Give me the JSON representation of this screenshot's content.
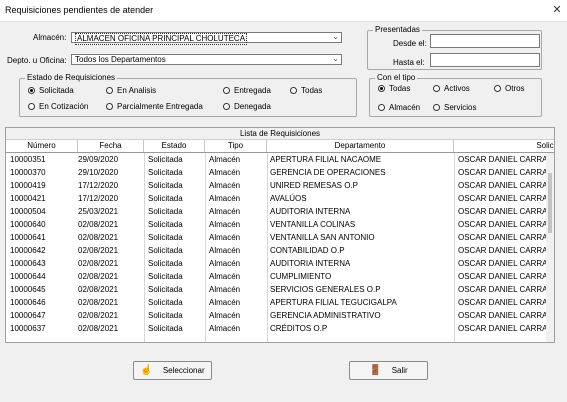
{
  "window": {
    "title": "Requisiciones pendientes de atender",
    "close": "✕"
  },
  "filters": {
    "almacen_label": "Almacén:",
    "almacen_value": "ALMACEN OFICINA PRINCIPAL CHOLUTECA",
    "depto_label": "Depto. u Oficina:",
    "depto_value": "Todos los Departamentos"
  },
  "estado_group": {
    "title": "Estado de Requisiciones",
    "options": [
      "Solicitada",
      "En Analisis",
      "Entregada",
      "Todas",
      "En Cotización",
      "Parcialmente Entregada",
      "Denegada"
    ],
    "selected": "Solicitada"
  },
  "presentadas": {
    "title": "Presentadas",
    "desde_label": "Desde el:",
    "hasta_label": "Hasta el:",
    "desde_value": "",
    "hasta_value": ""
  },
  "tipo_group": {
    "title": "Con el tipo",
    "options": [
      "Todas",
      "Activos",
      "Otros",
      "Almacén",
      "Servicios"
    ],
    "selected": "Todas"
  },
  "list": {
    "caption": "Lista de Requisiciones",
    "columns": [
      "Número",
      "Fecha",
      "Estado",
      "Tipo",
      "Departamento",
      "Solicitado"
    ],
    "rows": [
      [
        "10000351",
        "29/09/2020",
        "Solicitada",
        "Almacén",
        "APERTURA FILIAL NACAOME",
        "OSCAR DANIEL CARRA"
      ],
      [
        "10000370",
        "29/10/2020",
        "Solicitada",
        "Almacén",
        "GERENCIA DE OPERACIONES",
        "OSCAR DANIEL CARRA"
      ],
      [
        "10000419",
        "17/12/2020",
        "Solicitada",
        "Almacén",
        "UNIRED REMESAS O.P",
        "OSCAR DANIEL CARRA"
      ],
      [
        "10000421",
        "17/12/2020",
        "Solicitada",
        "Almacén",
        "AVALÚOS",
        "OSCAR DANIEL CARRA"
      ],
      [
        "10000504",
        "25/03/2021",
        "Solicitada",
        "Almacén",
        "AUDITORIA INTERNA",
        "OSCAR DANIEL CARRA"
      ],
      [
        "10000640",
        "02/08/2021",
        "Solicitada",
        "Almacén",
        "VENTANILLA COLINAS",
        "OSCAR DANIEL CARRA"
      ],
      [
        "10000641",
        "02/08/2021",
        "Solicitada",
        "Almacén",
        "VENTANILLA SAN ANTONIO",
        "OSCAR DANIEL CARRA"
      ],
      [
        "10000642",
        "02/08/2021",
        "Solicitada",
        "Almacén",
        "CONTABILIDAD O.P",
        "OSCAR DANIEL CARRA"
      ],
      [
        "10000643",
        "02/08/2021",
        "Solicitada",
        "Almacén",
        "AUDITORIA INTERNA",
        "OSCAR DANIEL CARRA"
      ],
      [
        "10000644",
        "02/08/2021",
        "Solicitada",
        "Almacén",
        "CUMPLIMIENTO",
        "OSCAR DANIEL CARRA"
      ],
      [
        "10000645",
        "02/08/2021",
        "Solicitada",
        "Almacén",
        "SERVICIOS GENERALES O.P",
        "OSCAR DANIEL CARRA"
      ],
      [
        "10000646",
        "02/08/2021",
        "Solicitada",
        "Almacén",
        "APERTURA FILIAL TEGUCIGALPA",
        "OSCAR DANIEL CARRA"
      ],
      [
        "10000647",
        "02/08/2021",
        "Solicitada",
        "Almacén",
        "GERENCIA ADMINISTRATIVO",
        "OSCAR DANIEL CARRA"
      ],
      [
        "10000637",
        "02/08/2021",
        "Solicitada",
        "Almacén",
        "CRÉDITOS O.P",
        "OSCAR DANIEL CARRA"
      ]
    ]
  },
  "buttons": {
    "select_label": "Seleccionar",
    "select_icon": "hand-pointer-icon",
    "exit_label": "Salir",
    "exit_icon": "exit-door-icon"
  }
}
